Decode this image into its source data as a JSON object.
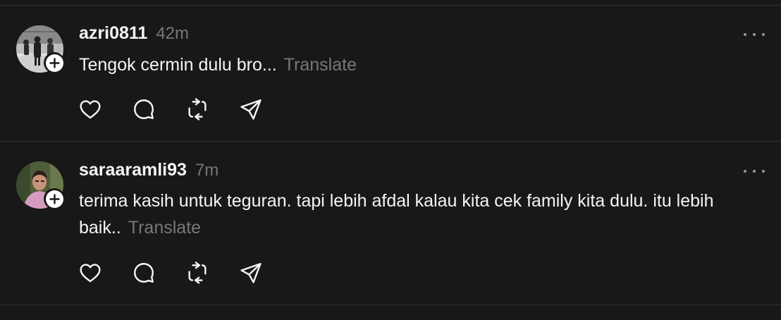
{
  "posts": [
    {
      "username": "azri0811",
      "time": "42m",
      "text": "Tengok cermin dulu bro...",
      "translate_label": "Translate",
      "icons": {
        "more": "more-horizontal-icon",
        "like": "heart-icon",
        "reply": "comment-icon",
        "repost": "repost-icon",
        "share": "send-icon",
        "follow": "plus-icon"
      }
    },
    {
      "username": "saraaramli93",
      "time": "7m",
      "text": "terima kasih untuk teguran. tapi lebih afdal kalau kita cek family kita dulu. itu lebih baik..",
      "translate_label": "Translate",
      "icons": {
        "more": "more-horizontal-icon",
        "like": "heart-icon",
        "reply": "comment-icon",
        "repost": "repost-icon",
        "share": "send-icon",
        "follow": "plus-icon"
      }
    }
  ],
  "colors": {
    "background": "#181818",
    "primary_text": "#f3f5f7",
    "secondary_text": "#777777",
    "divider": "#323232",
    "icon": "#f3f5f7"
  }
}
